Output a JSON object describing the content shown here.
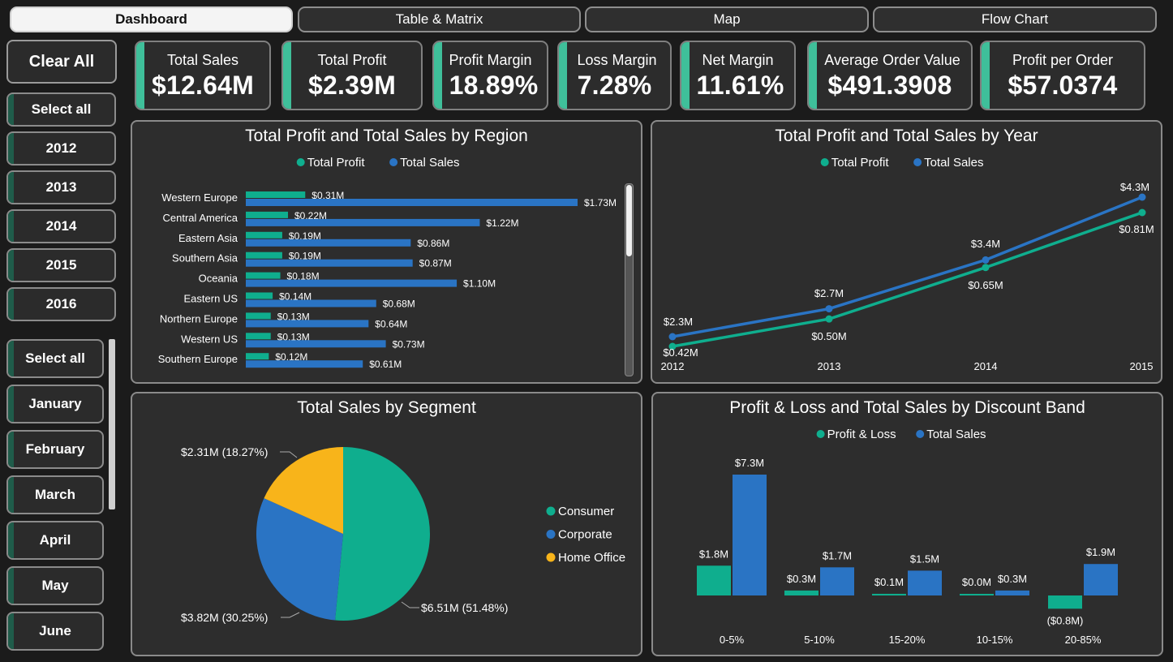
{
  "colors": {
    "teal": "#0fae8e",
    "blue": "#2a74c4",
    "yellow": "#f8b41a",
    "panel": "#2d2d2d"
  },
  "tabs": [
    "Dashboard",
    "Table & Matrix",
    "Map",
    "Flow Chart"
  ],
  "slicers": {
    "clear_all": "Clear All",
    "years": [
      "Select all",
      "2012",
      "2013",
      "2014",
      "2015",
      "2016"
    ],
    "months": [
      "Select all",
      "January",
      "February",
      "March",
      "April",
      "May",
      "June"
    ]
  },
  "kpis": [
    {
      "label": "Total Sales",
      "value": "$12.64M"
    },
    {
      "label": "Total Profit",
      "value": "$2.39M"
    },
    {
      "label": "Profit Margin",
      "value": "18.89%"
    },
    {
      "label": "Loss Margin",
      "value": "7.28%"
    },
    {
      "label": "Net Margin",
      "value": "11.61%"
    },
    {
      "label": "Average Order Value",
      "value": "$491.3908"
    },
    {
      "label": "Profit per Order",
      "value": "$57.0374"
    }
  ],
  "chart_data": [
    {
      "type": "bar",
      "orientation": "horizontal",
      "title": "Total Profit and Total Sales by Region",
      "legend": [
        "Total Profit",
        "Total Sales"
      ],
      "categories": [
        "Western Europe",
        "Central America",
        "Eastern Asia",
        "Southern Asia",
        "Oceania",
        "Eastern US",
        "Northern Europe",
        "Western US",
        "Southern Europe"
      ],
      "series": [
        {
          "name": "Total Profit",
          "values": [
            0.31,
            0.22,
            0.19,
            0.19,
            0.18,
            0.14,
            0.13,
            0.13,
            0.12
          ],
          "labels": [
            "$0.31M",
            "$0.22M",
            "$0.19M",
            "$0.19M",
            "$0.18M",
            "$0.14M",
            "$0.13M",
            "$0.13M",
            "$0.12M"
          ]
        },
        {
          "name": "Total Sales",
          "values": [
            1.73,
            1.22,
            0.86,
            0.87,
            1.1,
            0.68,
            0.64,
            0.73,
            0.61
          ],
          "labels": [
            "$1.73M",
            "$1.22M",
            "$0.86M",
            "$0.87M",
            "$1.10M",
            "$0.68M",
            "$0.64M",
            "$0.73M",
            "$0.61M"
          ]
        }
      ],
      "xlim": [
        0,
        1.73
      ]
    },
    {
      "type": "line",
      "title": "Total Profit and Total Sales by Year",
      "legend": [
        "Total Profit",
        "Total Sales"
      ],
      "x": [
        "2012",
        "2013",
        "2014",
        "2015"
      ],
      "series": [
        {
          "name": "Total Profit",
          "values": [
            0.42,
            0.5,
            0.65,
            0.81
          ],
          "labels": [
            "$0.42M",
            "$0.50M",
            "$0.65M",
            "$0.81M"
          ]
        },
        {
          "name": "Total Sales",
          "values": [
            2.3,
            2.7,
            3.4,
            4.3
          ],
          "labels": [
            "$2.3M",
            "$2.7M",
            "$3.4M",
            "$4.3M"
          ]
        }
      ]
    },
    {
      "type": "pie",
      "title": "Total Sales by Segment",
      "legend": [
        "Consumer",
        "Corporate",
        "Home Office"
      ],
      "slices": [
        {
          "name": "Consumer",
          "value": 51.48,
          "label": "$6.51M (51.48%)"
        },
        {
          "name": "Corporate",
          "value": 30.25,
          "label": "$3.82M (30.25%)"
        },
        {
          "name": "Home Office",
          "value": 18.27,
          "label": "$2.31M (18.27%)"
        }
      ]
    },
    {
      "type": "bar",
      "title": "Profit & Loss and Total Sales by Discount Band",
      "legend": [
        "Profit & Loss",
        "Total Sales"
      ],
      "categories": [
        "0-5%",
        "5-10%",
        "15-20%",
        "10-15%",
        "20-85%"
      ],
      "series": [
        {
          "name": "Profit & Loss",
          "values": [
            1.8,
            0.3,
            0.1,
            0.0,
            -0.8
          ],
          "labels": [
            "$1.8M",
            "$0.3M",
            "$0.1M",
            "$0.0M",
            "($0.8M)"
          ]
        },
        {
          "name": "Total Sales",
          "values": [
            7.3,
            1.7,
            1.5,
            0.3,
            1.9
          ],
          "labels": [
            "$7.3M",
            "$1.7M",
            "$1.5M",
            "$0.3M",
            "$1.9M"
          ]
        }
      ]
    }
  ]
}
